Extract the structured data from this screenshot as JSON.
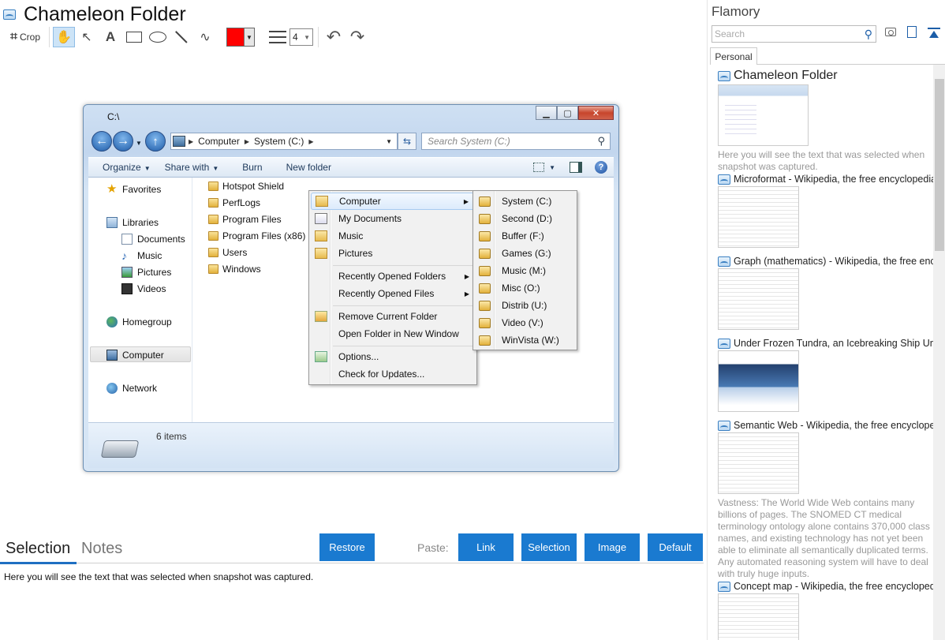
{
  "app": {
    "document_title": "Chameleon Folder"
  },
  "toolbar": {
    "crop_label": "Crop",
    "text_tool_glyph": "A",
    "stroke_color": "#ff0000",
    "line_width": "4",
    "tools": [
      "crop-icon",
      "hand-icon",
      "pointer-icon",
      "text-icon",
      "rectangle-icon",
      "ellipse-icon",
      "line-icon",
      "freehand-icon",
      "color-picker",
      "line-width-icon",
      "undo-icon",
      "redo-icon"
    ]
  },
  "explorer": {
    "window_title": "C:\\",
    "address": [
      "Computer",
      "System (C:)"
    ],
    "search_placeholder": "Search System (C:)",
    "commands": [
      "Organize",
      "Share with",
      "Burn",
      "New folder"
    ],
    "nav": {
      "favorites": "Favorites",
      "libraries": "Libraries",
      "documents": "Documents",
      "music": "Music",
      "pictures": "Pictures",
      "videos": "Videos",
      "homegroup": "Homegroup",
      "computer": "Computer",
      "network": "Network"
    },
    "folders": [
      "Hotspot Shield",
      "PerfLogs",
      "Program Files",
      "Program Files (x86)",
      "Users",
      "Windows"
    ],
    "status": "6 items"
  },
  "context_menu": {
    "items": [
      "Computer",
      "My Documents",
      "Music",
      "Pictures"
    ],
    "recent_folders": "Recently Opened Folders",
    "recent_files": "Recently Opened Files",
    "remove_current": "Remove Current Folder",
    "open_new_window": "Open Folder in New Window",
    "options": "Options...",
    "check_updates": "Check for Updates..."
  },
  "drives_submenu": [
    "System (C:)",
    "Second (D:)",
    "Buffer (F:)",
    "Games (G:)",
    "Music (M:)",
    "Misc (O:)",
    "Distrib (U:)",
    "Video (V:)",
    "WinVista (W:)"
  ],
  "bottom": {
    "tab_selection": "Selection",
    "tab_notes": "Notes",
    "restore_label": "Restore",
    "paste_label": "Paste:",
    "paste_buttons": [
      "Link",
      "Selection",
      "Image",
      "Default"
    ],
    "selection_text": "Here you will see the text that was selected when snapshot was captured.",
    "accent_color": "#1a7ad0"
  },
  "flamory": {
    "title": "Flamory",
    "search_placeholder": "Search",
    "tab": "Personal",
    "entries": [
      {
        "title": "Chameleon Folder",
        "desc": "Here you will see the text that was selected when snapshot was captured."
      },
      {
        "title": "Microformat - Wikipedia, the free encyclopedia",
        "desc": ""
      },
      {
        "title": "Graph (mathematics) - Wikipedia, the free ency",
        "desc": ""
      },
      {
        "title": "Under Frozen Tundra, an Icebreaking Ship Unco",
        "desc": ""
      },
      {
        "title": "Semantic Web - Wikipedia, the free encycloped",
        "desc": "Vastness: The World Wide Web contains many billions of pages. The SNOMED CT medical terminology ontology alone contains 370,000 class names, and existing technology has not yet been able to eliminate all semantically duplicated terms. Any automated reasoning system will have to deal with truly huge inputs."
      },
      {
        "title": "Concept map - Wikipedia, the free encyclopedi",
        "desc": ""
      }
    ]
  }
}
